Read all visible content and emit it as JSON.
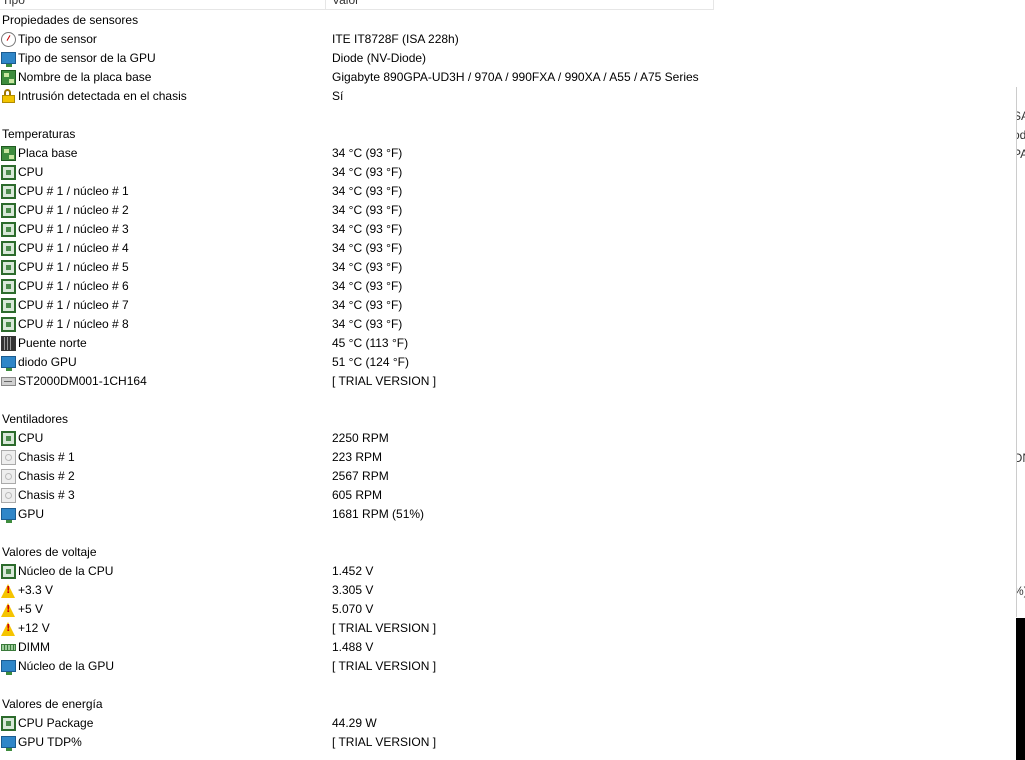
{
  "header": {
    "col1": "Tipo",
    "col2": "Valor"
  },
  "rows": [
    {
      "type": "group",
      "name": "Propiedades de sensores"
    },
    {
      "type": "item",
      "icon": "sensor-icon",
      "name": "Tipo de sensor",
      "value": "ITE IT8728F  (ISA 228h)"
    },
    {
      "type": "item",
      "icon": "monitor-icon",
      "name": "Tipo de sensor de la GPU",
      "value": "Diode  (NV-Diode)"
    },
    {
      "type": "item",
      "icon": "motherboard-icon",
      "name": "Nombre de la placa base",
      "value": "Gigabyte 890GPA-UD3H / 970A / 990FXA / 990XA / A55 / A75 Series"
    },
    {
      "type": "item",
      "icon": "lock-icon",
      "name": "Intrusión detectada en el chasis",
      "value": "Sí"
    },
    {
      "type": "blank"
    },
    {
      "type": "group",
      "name": "Temperaturas"
    },
    {
      "type": "item",
      "icon": "motherboard-icon",
      "name": "Placa base",
      "value": "34 °C  (93 °F)"
    },
    {
      "type": "item",
      "icon": "cpu-chip-icon",
      "name": "CPU",
      "value": "34 °C  (93 °F)"
    },
    {
      "type": "item",
      "icon": "cpu-chip-icon",
      "name": "CPU # 1 / núcleo # 1",
      "value": "34 °C  (93 °F)"
    },
    {
      "type": "item",
      "icon": "cpu-chip-icon",
      "name": "CPU # 1 / núcleo # 2",
      "value": "34 °C  (93 °F)"
    },
    {
      "type": "item",
      "icon": "cpu-chip-icon",
      "name": "CPU # 1 / núcleo # 3",
      "value": "34 °C  (93 °F)"
    },
    {
      "type": "item",
      "icon": "cpu-chip-icon",
      "name": "CPU # 1 / núcleo # 4",
      "value": "34 °C  (93 °F)"
    },
    {
      "type": "item",
      "icon": "cpu-chip-icon",
      "name": "CPU # 1 / núcleo # 5",
      "value": "34 °C  (93 °F)"
    },
    {
      "type": "item",
      "icon": "cpu-chip-icon",
      "name": "CPU # 1 / núcleo # 6",
      "value": "34 °C  (93 °F)"
    },
    {
      "type": "item",
      "icon": "cpu-chip-icon",
      "name": "CPU # 1 / núcleo # 7",
      "value": "34 °C  (93 °F)"
    },
    {
      "type": "item",
      "icon": "cpu-chip-icon",
      "name": "CPU # 1 / núcleo # 8",
      "value": "34 °C  (93 °F)"
    },
    {
      "type": "item",
      "icon": "northbridge-icon",
      "name": "Puente norte",
      "value": "45 °C  (113 °F)"
    },
    {
      "type": "item",
      "icon": "monitor-icon",
      "name": "diodo GPU",
      "value": "51 °C  (124 °F)"
    },
    {
      "type": "item",
      "icon": "hard-drive-icon",
      "name": "ST2000DM001-1CH164",
      "value": "[ TRIAL VERSION ]"
    },
    {
      "type": "blank"
    },
    {
      "type": "group",
      "name": "Ventiladores"
    },
    {
      "type": "item",
      "icon": "cpu-chip-icon",
      "name": "CPU",
      "value": "2250 RPM"
    },
    {
      "type": "item",
      "icon": "chassis-fan-icon",
      "name": "Chasis # 1",
      "value": "223 RPM"
    },
    {
      "type": "item",
      "icon": "chassis-fan-icon",
      "name": "Chasis # 2",
      "value": "2567 RPM"
    },
    {
      "type": "item",
      "icon": "chassis-fan-icon",
      "name": "Chasis # 3",
      "value": "605 RPM"
    },
    {
      "type": "item",
      "icon": "monitor-icon",
      "name": "GPU",
      "value": "1681 RPM  (51%)"
    },
    {
      "type": "blank"
    },
    {
      "type": "group",
      "name": "Valores de voltaje"
    },
    {
      "type": "item",
      "icon": "cpu-chip-icon",
      "name": "Núcleo de la CPU",
      "value": "1.452 V"
    },
    {
      "type": "item",
      "icon": "warning-icon",
      "name": "+3.3 V",
      "value": "3.305 V"
    },
    {
      "type": "item",
      "icon": "warning-icon",
      "name": "+5 V",
      "value": "5.070 V"
    },
    {
      "type": "item",
      "icon": "warning-icon",
      "name": "+12 V",
      "value": "[ TRIAL VERSION ]"
    },
    {
      "type": "item",
      "icon": "memory-icon",
      "name": "DIMM",
      "value": "1.488 V"
    },
    {
      "type": "item",
      "icon": "monitor-icon",
      "name": "Núcleo de la GPU",
      "value": "[ TRIAL VERSION ]"
    },
    {
      "type": "blank"
    },
    {
      "type": "group",
      "name": "Valores de energía"
    },
    {
      "type": "item",
      "icon": "cpu-chip-icon",
      "name": "CPU Package",
      "value": "44.29 W"
    },
    {
      "type": "item",
      "icon": "monitor-icon",
      "name": "GPU TDP%",
      "value": "[ TRIAL VERSION ]"
    }
  ],
  "right_fragment": [
    "SA",
    "od",
    "PA",
    "ON",
    "%)"
  ]
}
